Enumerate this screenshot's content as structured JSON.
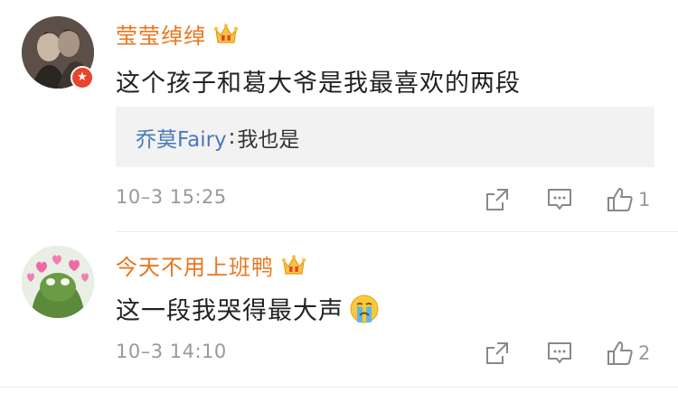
{
  "comments": [
    {
      "username": "莹莹绰绰",
      "text": "这个孩子和葛大爷是我最喜欢的两段",
      "reply": {
        "name": "乔莫Fairy",
        "separator": ": ",
        "text": "我也是"
      },
      "timestamp": "10–3 15:25",
      "likes": "1",
      "avatar_icon": "portrait-avatar",
      "badge": "verified-v-badge"
    },
    {
      "username": "今天不用上班鸭",
      "text": "这一段我哭得最大声",
      "emoji": "crying-face-emoji",
      "timestamp": "10–3 14:10",
      "likes": "2",
      "avatar_icon": "frog-hearts-avatar"
    }
  ],
  "colors": {
    "username": "#e8761f",
    "reply_name": "#4a78b8",
    "meta": "#999999",
    "reply_bg": "#f2f2f2"
  }
}
